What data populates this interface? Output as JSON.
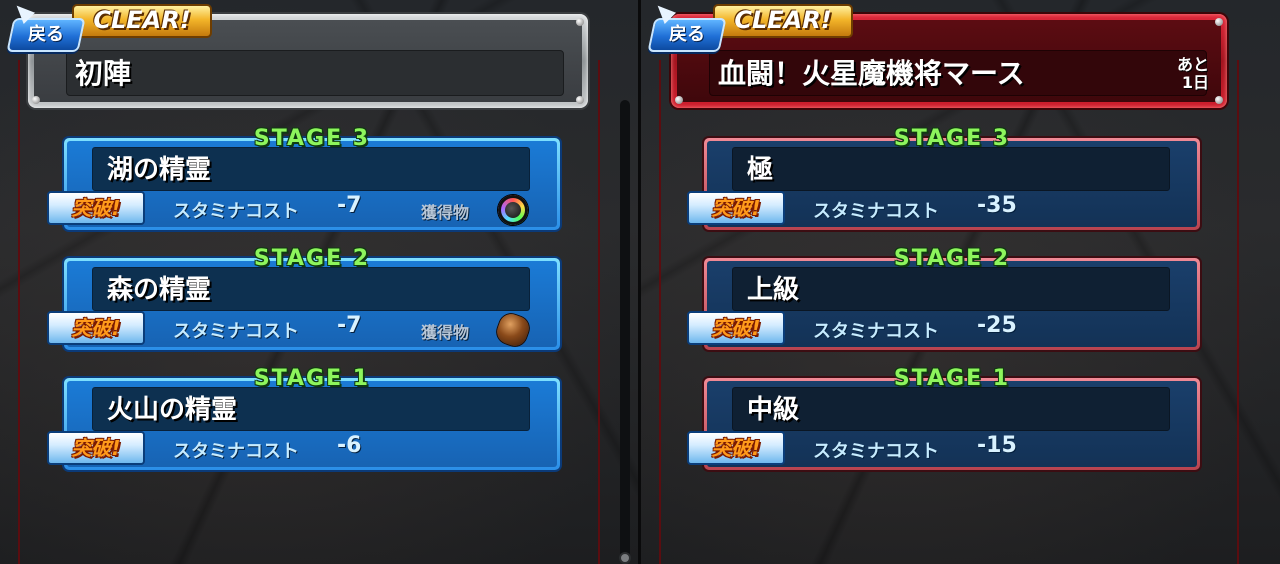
{
  "panels": [
    {
      "back_label": "戻る",
      "clear_label": "CLEAR!",
      "title": "初陣",
      "remaining": "",
      "stages": [
        {
          "label": "STAGE 3",
          "name": "湖の精霊",
          "badge": "突破!",
          "stamina_label": "スタミナコスト",
          "stamina": "-7",
          "loot_label": "獲得物",
          "loot_icon": "rainbow-orb-icon"
        },
        {
          "label": "STAGE 2",
          "name": "森の精霊",
          "badge": "突破!",
          "stamina_label": "スタミナコスト",
          "stamina": "-7",
          "loot_label": "獲得物",
          "loot_icon": "rock-orb-icon"
        },
        {
          "label": "STAGE 1",
          "name": "火山の精霊",
          "badge": "突破!",
          "stamina_label": "スタミナコスト",
          "stamina": "-6",
          "loot_label": "",
          "loot_icon": ""
        }
      ]
    },
    {
      "back_label": "戻る",
      "clear_label": "CLEAR!",
      "title": "血闘！火星魔機将マース",
      "remaining_top": "あと",
      "remaining_bottom": "1日",
      "stages": [
        {
          "label": "STAGE 3",
          "name": "極",
          "badge": "突破!",
          "stamina_label": "スタミナコスト",
          "stamina": "-35"
        },
        {
          "label": "STAGE 2",
          "name": "上級",
          "badge": "突破!",
          "stamina_label": "スタミナコスト",
          "stamina": "-25"
        },
        {
          "label": "STAGE 1",
          "name": "中級",
          "badge": "突破!",
          "stamina_label": "スタミナコスト",
          "stamina": "-15"
        }
      ]
    }
  ],
  "colors": {
    "stage_label": "#8df55c",
    "card_blue": "#1b7bd6",
    "card_navy": "#1a3f6b",
    "header_silver": "#c7cacc",
    "header_red": "#d11f2e",
    "clear_gold": "#f3b52a",
    "breakthrough_text": "#ff9a1a"
  }
}
